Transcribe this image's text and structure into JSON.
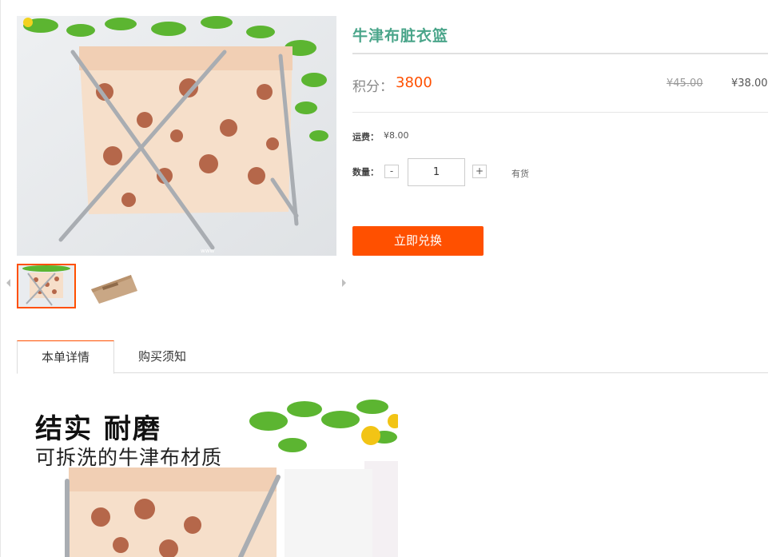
{
  "product": {
    "title": "牛津布脏衣篮",
    "points_label": "积分：",
    "points_value": "3800",
    "original_price": "¥45.00",
    "current_price": "¥38.00",
    "shipping_label": "运费：",
    "shipping_value": "¥8.00",
    "quantity_label": "数量：",
    "quantity_minus": "-",
    "quantity_value": "1",
    "quantity_plus": "+",
    "stock_status": "有货",
    "redeem_button": "立即兑换"
  },
  "gallery": {
    "thumbnails": [
      "laundry-basket-open",
      "laundry-basket-folded"
    ],
    "selected_index": 0
  },
  "tabs": [
    {
      "label": "本单详情",
      "active": true
    },
    {
      "label": "购买须知",
      "active": false
    }
  ],
  "detail_banner": {
    "headline": "结实  耐磨",
    "subline": "可拆洗的牛津布材质"
  },
  "colors": {
    "accent": "#ff5000",
    "title": "#4aa58a",
    "rule": "#e0e0e0"
  }
}
